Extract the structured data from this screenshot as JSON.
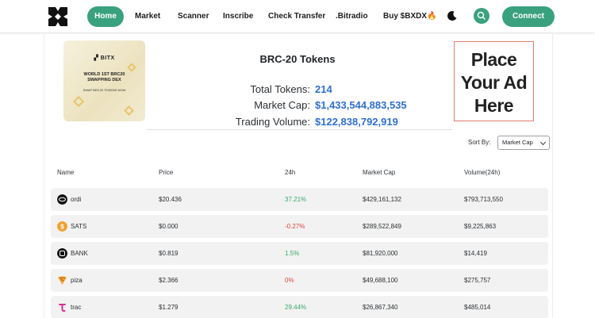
{
  "nav": {
    "items": [
      "Home",
      "Market",
      "Scanner",
      "Inscribe",
      "Check Transfer",
      ".Bitradio",
      "Buy $BXDX🔥"
    ],
    "connect_label": "Connect",
    "accent_color": "#3aa17e"
  },
  "promo": {
    "logo": "BITX",
    "title_line1": "WORLD 1ST BRC20",
    "title_line2": "SWAPPING DEX",
    "subtitle": "SWAP BRC20 TOKENS NOW"
  },
  "stats": {
    "title": "BRC-20 Tokens",
    "total_tokens_label": "Total Tokens:",
    "total_tokens_value": "214",
    "market_cap_label": "Market Cap:",
    "market_cap_value": "$1,433,544,883,535",
    "trading_volume_label": "Trading Volume:",
    "trading_volume_value": "$122,838,792,919"
  },
  "ad": {
    "line1": "Place",
    "line2": "Your Ad",
    "line3": "Here"
  },
  "sort": {
    "label": "Sort By:",
    "selected": "Market Cap"
  },
  "table": {
    "headers": [
      "Name",
      "Price",
      "24h",
      "Market Cap",
      "Volume(24h)"
    ],
    "rows": [
      {
        "name": "ordi",
        "price": "$20.436",
        "change": "37.21%",
        "trend": "up",
        "market_cap": "$429,161,132",
        "volume": "$793,713,550",
        "icon": "ordi-icon"
      },
      {
        "name": "SATS",
        "price": "$0.000",
        "change": "-0.27%",
        "trend": "down",
        "market_cap": "$289,522,849",
        "volume": "$9,225,863",
        "icon": "sats-icon"
      },
      {
        "name": "BANK",
        "price": "$0.819",
        "change": "1.5%",
        "trend": "up",
        "market_cap": "$81,920,000",
        "volume": "$14,419",
        "icon": "bank-icon"
      },
      {
        "name": "piza",
        "price": "$2.366",
        "change": "0%",
        "trend": "down",
        "market_cap": "$49,688,100",
        "volume": "$275,757",
        "icon": "piza-icon"
      },
      {
        "name": "trac",
        "price": "$1.279",
        "change": "29.44%",
        "trend": "up",
        "market_cap": "$26,867,340",
        "volume": "$485,014",
        "icon": "trac-icon"
      }
    ]
  }
}
